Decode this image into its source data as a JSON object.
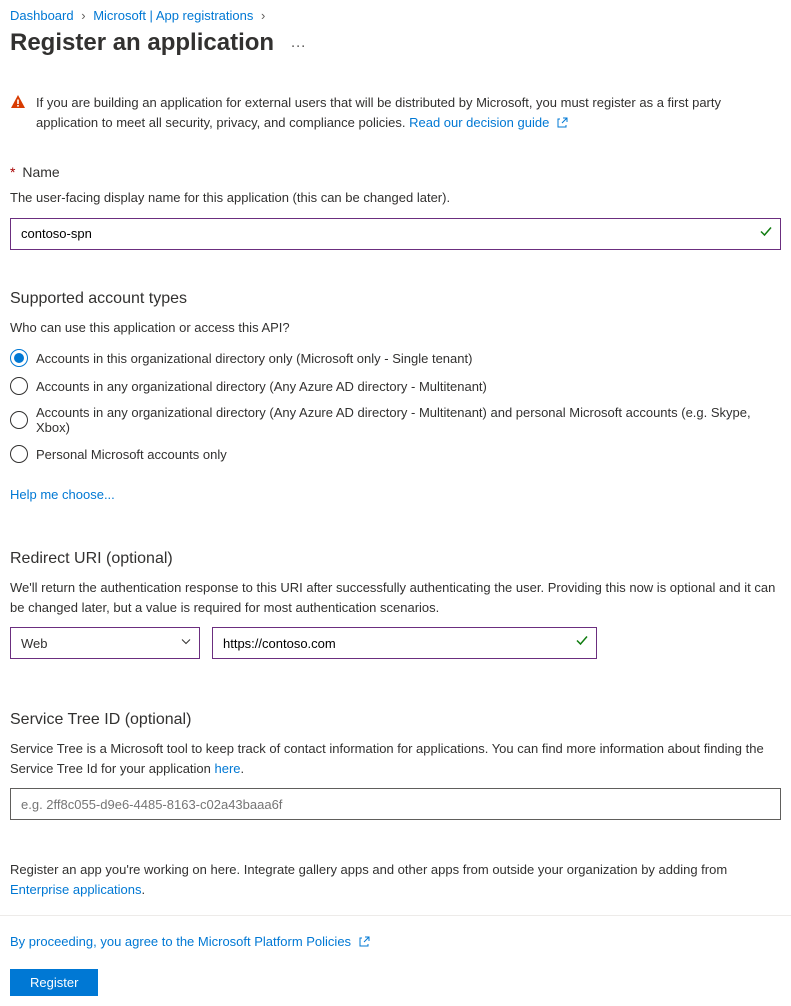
{
  "breadcrumb": {
    "items": [
      {
        "label": "Dashboard"
      },
      {
        "label": "Microsoft | App registrations"
      }
    ]
  },
  "page_title": "Register an application",
  "warning": {
    "text": "If you are building an application for external users that will be distributed by Microsoft, you must register as a first party application to meet all security, privacy, and compliance policies. ",
    "link": "Read our decision guide"
  },
  "name_section": {
    "label": "Name",
    "help": "The user-facing display name for this application (this can be changed later).",
    "value": "contoso-spn"
  },
  "account_types": {
    "heading": "Supported account types",
    "question": "Who can use this application or access this API?",
    "options": [
      {
        "label": "Accounts in this organizational directory only (Microsoft only - Single tenant)",
        "selected": true
      },
      {
        "label": "Accounts in any organizational directory (Any Azure AD directory - Multitenant)",
        "selected": false
      },
      {
        "label": "Accounts in any organizational directory (Any Azure AD directory - Multitenant) and personal Microsoft accounts (e.g. Skype, Xbox)",
        "selected": false
      },
      {
        "label": "Personal Microsoft accounts only",
        "selected": false
      }
    ],
    "help_link": "Help me choose..."
  },
  "redirect_uri": {
    "heading": "Redirect URI (optional)",
    "help": "We'll return the authentication response to this URI after successfully authenticating the user. Providing this now is optional and it can be changed later, but a value is required for most authentication scenarios.",
    "platform": "Web",
    "uri": "https://contoso.com"
  },
  "service_tree": {
    "heading": "Service Tree ID (optional)",
    "help_prefix": "Service Tree is a Microsoft tool to keep track of contact information for applications. You can find more information about finding the Service Tree Id for your application ",
    "help_link": "here",
    "help_suffix": ".",
    "placeholder": "e.g. 2ff8c055-d9e6-4485-8163-c02a43baaa6f"
  },
  "footer": {
    "text_prefix": "Register an app you're working on here. Integrate gallery apps and other apps from outside your organization by adding from ",
    "link_text": "Enterprise applications",
    "text_suffix": "."
  },
  "policy": {
    "text": "By proceeding, you agree to the Microsoft Platform Policies"
  },
  "register_button": "Register"
}
